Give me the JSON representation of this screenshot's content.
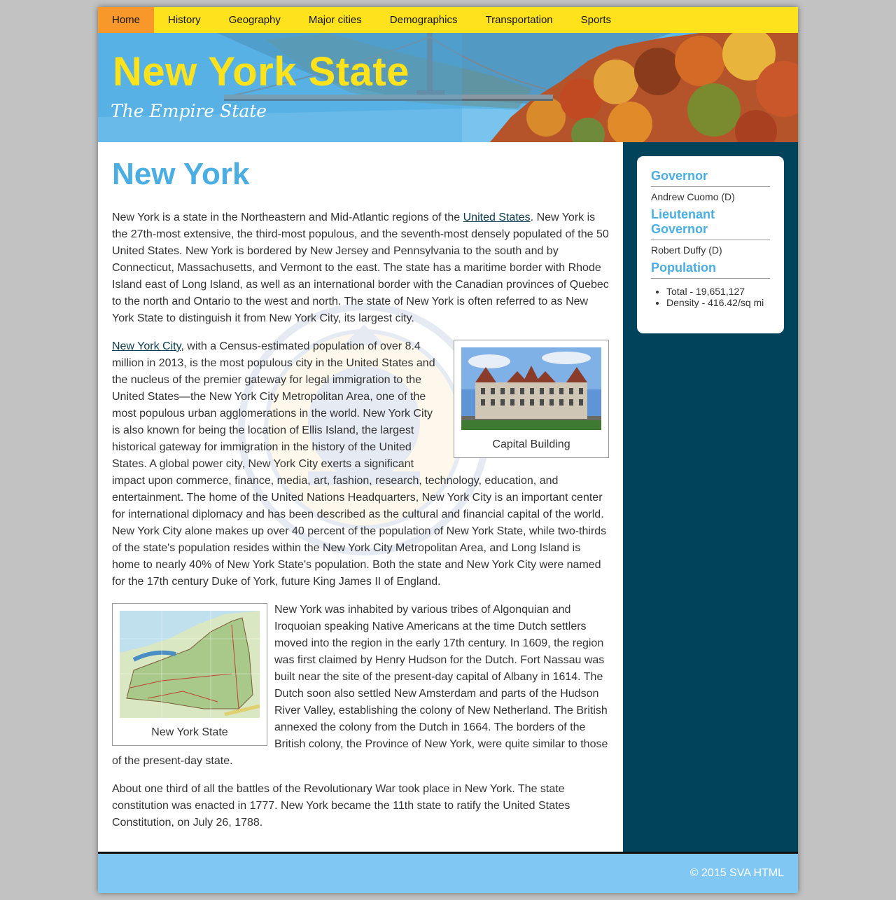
{
  "nav": {
    "items": [
      {
        "label": "Home",
        "active": true
      },
      {
        "label": "History"
      },
      {
        "label": "Geography"
      },
      {
        "label": "Major cities"
      },
      {
        "label": "Demographics"
      },
      {
        "label": "Transportation"
      },
      {
        "label": "Sports"
      }
    ]
  },
  "banner": {
    "title": "New York State",
    "tagline": "The Empire State"
  },
  "main": {
    "title": "New York",
    "p1_before": "New York is a state in the Northeastern and Mid-Atlantic regions of the ",
    "p1_link": "United States",
    "p1_after": ". New York is the 27th-most extensive, the third-most populous, and the seventh-most densely populated of the 50 United States. New York is bordered by New Jersey and Pennsylvania to the south and by Connecticut, Massachusetts, and Vermont to the east. The state has a maritime border with Rhode Island east of Long Island, as well as an international border with the Canadian provinces of Quebec to the north and Ontario to the west and north. The state of New York is often referred to as New York State to distinguish it from New York City, its largest city.",
    "p2_link": "New York City",
    "p2_after": ", with a Census-estimated population of over 8.4 million in 2013, is the most populous city in the United States and the nucleus of the premier gateway for legal immigration to the United States—the New York City Metropolitan Area, one of the most populous urban agglomerations in the world. New York City is also known for being the location of Ellis Island, the largest historical gateway for immigration in the history of the United States. A global power city, New York City exerts a significant impact upon commerce, finance, media, art, fashion, research, technology, education, and entertainment. The home of the United Nations Headquarters, New York City is an important center for international diplomacy and has been described as the cultural and financial capital of the world. New York City alone makes up over 40 percent of the population of New York State, while two-thirds of the state's population resides within the New York City Metropolitan Area, and Long Island is home to nearly 40% of New York State's population. Both the state and New York City were named for the 17th century Duke of York, future King James II of England.",
    "p3": "New York was inhabited by various tribes of Algonquian and Iroquoian speaking Native Americans at the time Dutch settlers moved into the region in the early 17th century. In 1609, the region was first claimed by Henry Hudson for the Dutch. Fort Nassau was built near the site of the present-day capital of Albany in 1614. The Dutch soon also settled New Amsterdam and parts of the Hudson River Valley, establishing the colony of New Netherland. The British annexed the colony from the Dutch in 1664. The borders of the British colony, the Province of New York, were quite similar to those of the present-day state.",
    "p4": "About one third of all the battles of the Revolutionary War took place in New York. The state constitution was enacted in 1777. New York became the 11th state to ratify the United States Constitution, on July 26, 1788.",
    "figure_capitol_caption": "Capital Building",
    "figure_map_caption": "New York State"
  },
  "sidebar": {
    "governor_heading": "Governor",
    "governor_value": "Andrew Cuomo (D)",
    "lt_governor_heading": "Lieutenant Governor",
    "lt_governor_value": "Robert Duffy (D)",
    "population_heading": "Population",
    "population_items": [
      "Total - 19,651,127",
      "Density - 416.42/sq mi"
    ]
  },
  "footer": {
    "copyright": "© 2015 SVA HTML"
  },
  "colors": {
    "nav_bg": "#fde21c",
    "nav_active": "#f8982b",
    "heading_blue": "#4aaee3",
    "sidebar_bg": "#01435a",
    "footer_bg": "#80c8f3"
  }
}
